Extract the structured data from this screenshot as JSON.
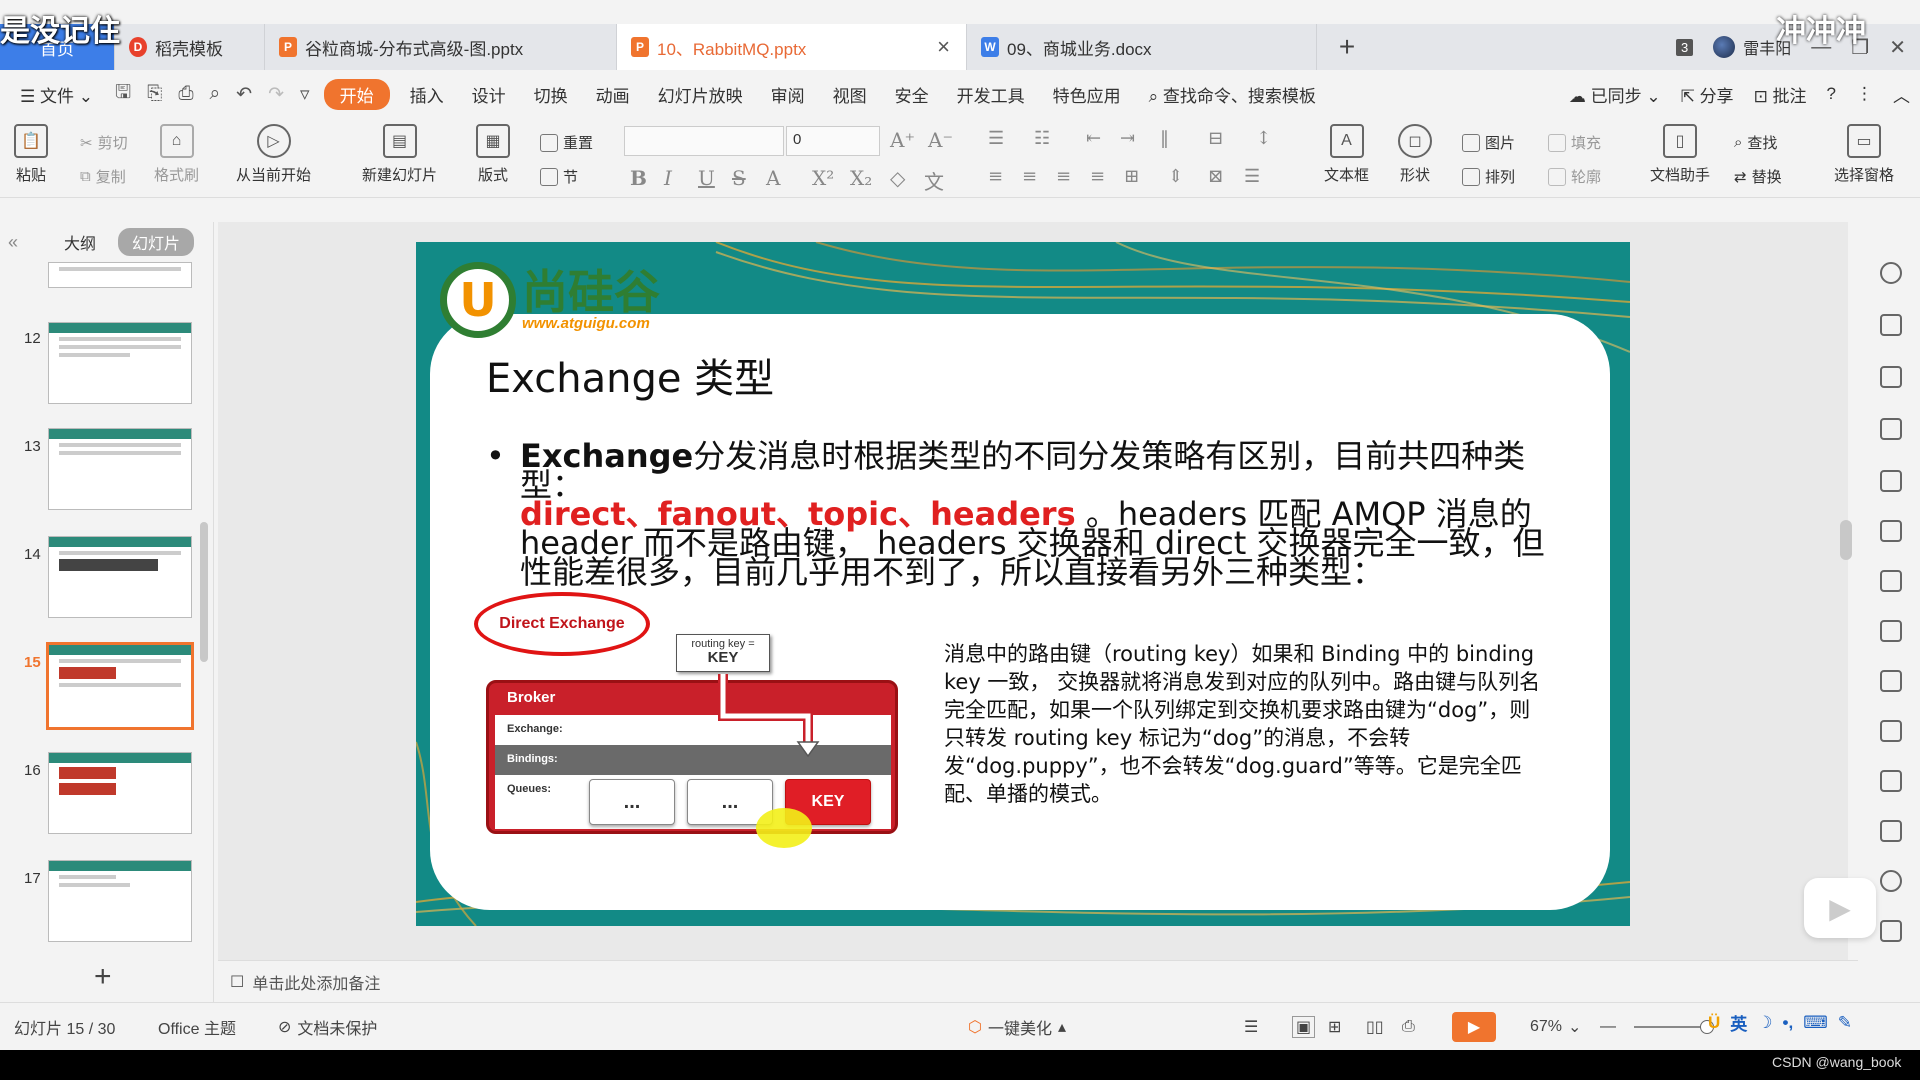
{
  "watermarks": {
    "top_left": "是没记住",
    "top_right": "冲冲冲",
    "bottom_right": "CSDN @wang_book"
  },
  "tabs": [
    {
      "label": "首页"
    },
    {
      "label": "稻壳模板"
    },
    {
      "label": "谷粒商城-分布式高级-图.pptx"
    },
    {
      "label": "10、RabbitMQ.pptx"
    },
    {
      "label": "09、商城业务.docx"
    }
  ],
  "tabbar_right": {
    "window_count": "3",
    "user": "雷丰阳"
  },
  "menu": {
    "file": "文件",
    "items": [
      "开始",
      "插入",
      "设计",
      "切换",
      "动画",
      "幻灯片放映",
      "审阅",
      "视图",
      "安全",
      "开发工具",
      "特色应用"
    ],
    "search": "查找命令、搜索模板",
    "sync": "已同步",
    "share": "分享",
    "comment": "批注"
  },
  "ribbon": {
    "paste": "粘贴",
    "cut": "剪切",
    "copy": "复制",
    "format_painter": "格式刷",
    "from_current": "从当前开始",
    "new_slide": "新建幻灯片",
    "layout": "版式",
    "reset": "重置",
    "section": "节",
    "font_size": "0",
    "textbox": "文本框",
    "shape": "形状",
    "picture": "图片",
    "arrange": "排列",
    "fill": "填充",
    "outline": "轮廓",
    "doc_assistant": "文档助手",
    "find": "查找",
    "replace": "替换",
    "select_pane": "选择窗格"
  },
  "left_panel": {
    "tab_outline": "大纲",
    "tab_slides": "幻灯片",
    "slide_numbers": [
      "12",
      "13",
      "14",
      "15",
      "16",
      "17"
    ],
    "selected": "15"
  },
  "slide": {
    "logo_cn": "尚硅谷",
    "logo_url": "www.atguigu.com",
    "title": "Exchange 类型",
    "bullet_bold": "Exchange",
    "bullet_text1": "分发消息时根据类型的不同分发策略有区别，目前共四种类型：",
    "bullet_red": "direct、fanout、topic、headers",
    "bullet_text2": " 。headers 匹配 AMQP 消息的 header 而不是路由键， headers 交换器和 direct 交换器完全一致，但性能差很多，目前几乎用不到了，所以直接看另外三种类型：",
    "diagram": {
      "label": "Direct Exchange",
      "routing_key_label": "routing key =",
      "routing_key_value": "KEY",
      "broker": "Broker",
      "exchange": "Exchange:",
      "bindings": "Bindings:",
      "queues": "Queues:",
      "queue1": "...",
      "queue2": "...",
      "queue3": "KEY"
    },
    "description": "消息中的路由键（routing key）如果和 Binding 中的 binding key 一致， 交换器就将消息发到对应的队列中。路由键与队列名完全匹配，如果一个队列绑定到交换机要求路由键为“dog”，则只转发 routing key 标记为“dog”的消息，不会转发“dog.puppy”，也不会转发“dog.guard”等等。它是完全匹配、单播的模式。"
  },
  "notes_placeholder": "单击此处添加备注",
  "status": {
    "slide_counter": "幻灯片 15 / 30",
    "theme": "Office 主题",
    "protect": "文档未保护",
    "beautify": "一键美化",
    "zoom": "67%"
  },
  "ime": {
    "lang": "英"
  },
  "colors": {
    "accent": "#f0742e",
    "home_tab": "#3d7ee8",
    "slide_bg": "#128a86",
    "highlight_red": "#e02020"
  }
}
